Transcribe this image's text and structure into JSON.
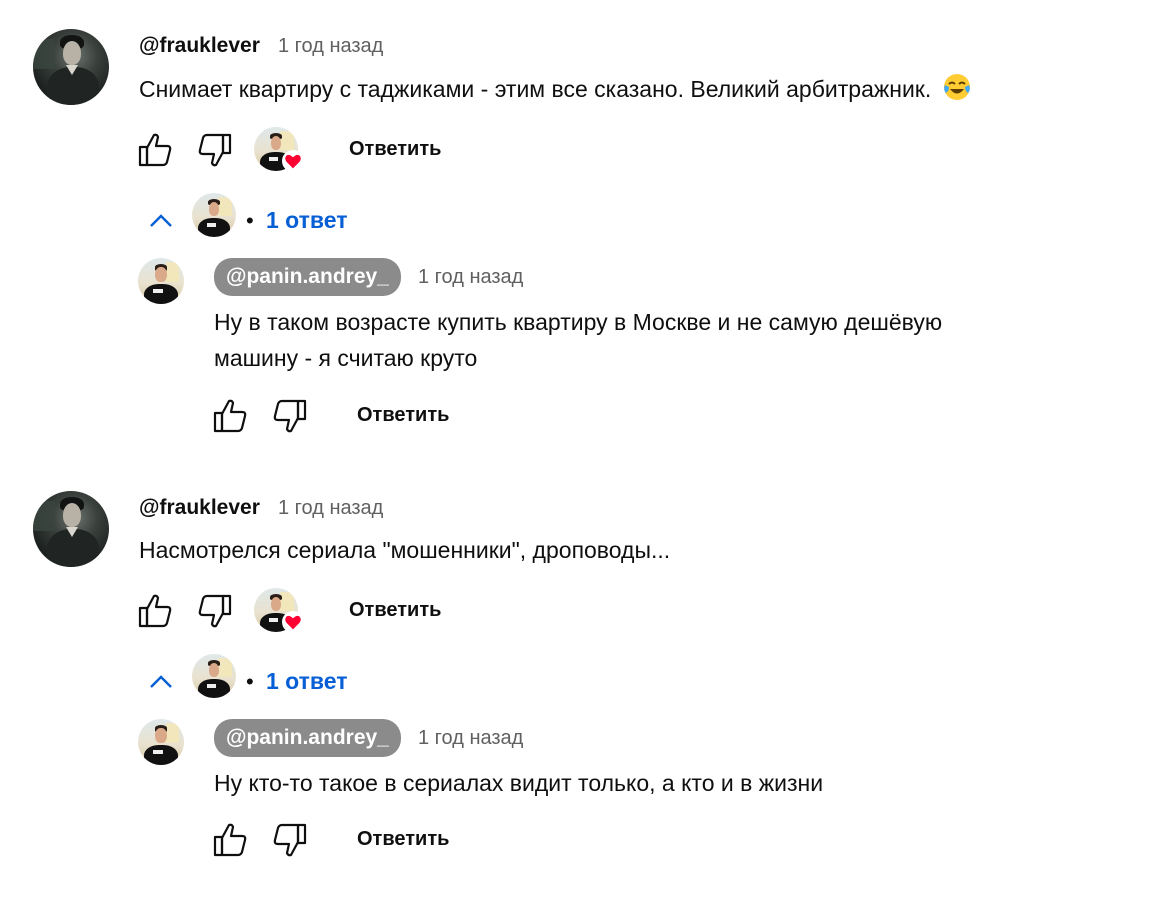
{
  "threads": [
    {
      "author": "@frauklever",
      "time": "1 год назад",
      "text": "Снимает квартиру с таджиками - этим все сказано. Великий арбитражник.",
      "emoji": "😂",
      "reply_label": "Ответить",
      "heart_color": "#ff0033",
      "replies_count_label": "1 ответ",
      "reply": {
        "author": "@panin.andrey_",
        "time": "1 год назад",
        "text_line1": "Ну в таком возрасте купить квартиру в Москве и не самую дешёвую",
        "text_line2": "машину - я считаю круто",
        "reply_label": "Ответить"
      }
    },
    {
      "author": "@frauklever",
      "time": "1 год назад",
      "text": "Насмотрелся сериала \"мошенники\", дроповоды...",
      "reply_label": "Ответить",
      "heart_color": "#ff0033",
      "replies_count_label": "1 ответ",
      "reply": {
        "author": "@panin.andrey_",
        "time": "1 год назад",
        "text_line1": "Ну кто-то такое в сериалах видит только, а кто и в жизни",
        "reply_label": "Ответить"
      }
    }
  ],
  "colors": {
    "link_blue": "#065fd4",
    "secondary_text": "#606060",
    "pill_bg": "#8b8b8b"
  },
  "icons": {
    "like": "thumbs-up-icon",
    "dislike": "thumbs-down-icon",
    "collapse": "chevron-up-icon",
    "heart": "heart-icon"
  }
}
